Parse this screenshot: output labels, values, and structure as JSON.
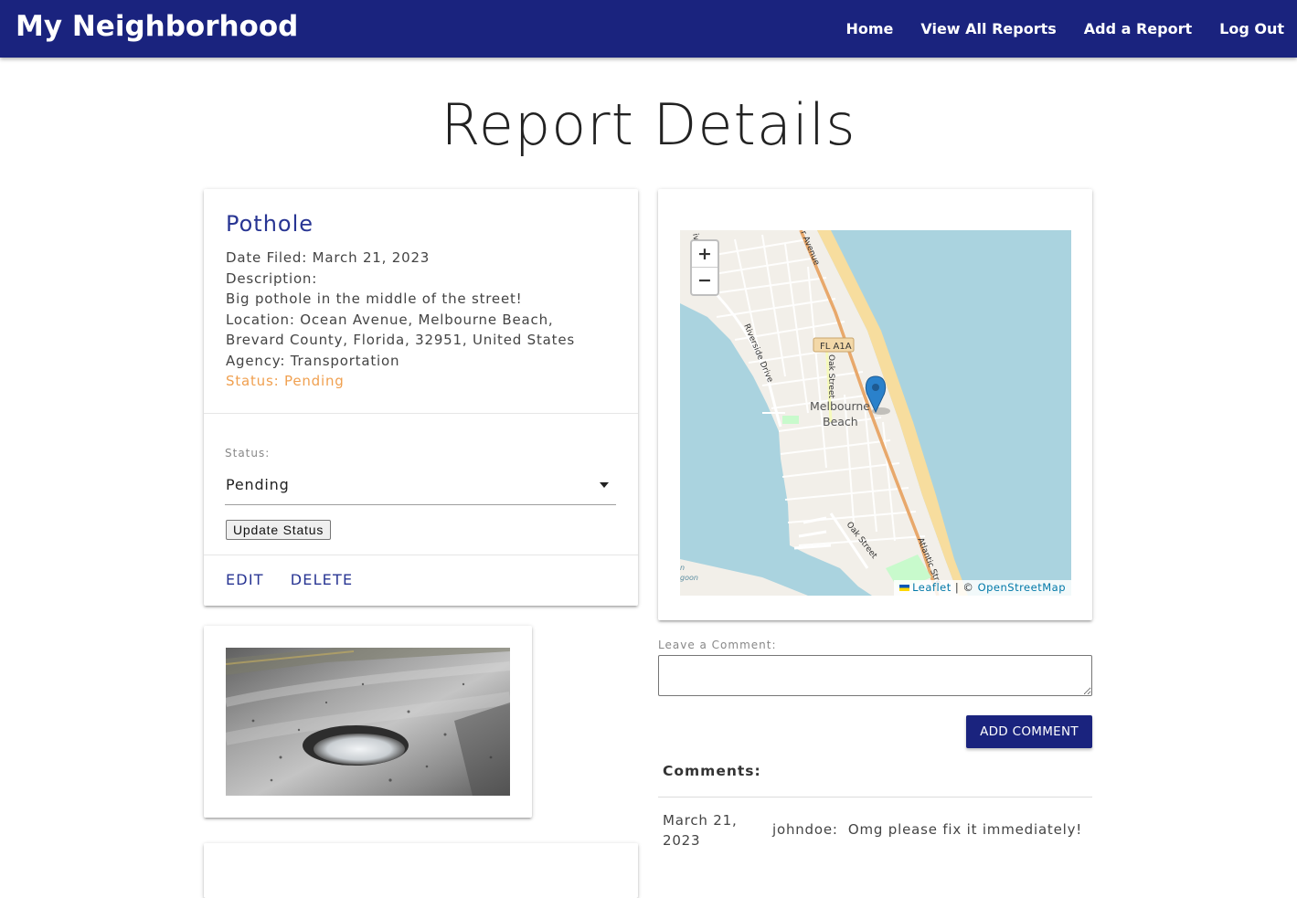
{
  "navbar": {
    "brand": "My Neighborhood",
    "links": [
      "Home",
      "View All Reports",
      "Add a Report",
      "Log Out"
    ]
  },
  "page_title": "Report Details",
  "report": {
    "title": "Pothole",
    "date_filed": "Date Filed: March 21, 2023",
    "description_label": "Description:",
    "description": "Big pothole in the middle of the street!",
    "location_line1": "Location: Ocean Avenue, Melbourne Beach,",
    "location_line2": "Brevard County, Florida, 32951, United States",
    "agency": "Agency: Transportation",
    "status": "Status: Pending",
    "status_color": "#f0a050"
  },
  "status_form": {
    "label": "Status:",
    "selected": "Pending",
    "update_button": "Update Status"
  },
  "actions": {
    "edit": "EDIT",
    "delete": "DELETE"
  },
  "map": {
    "zoom_in": "+",
    "zoom_out": "−",
    "labels": {
      "fl_a1a": "FL A1A",
      "oak_street": "Oak Street",
      "oak_street_2": "Oak Street",
      "riverside": "Riverside Drive",
      "atlantic": "Atlantic Stre",
      "avenue": "r Avenue",
      "town": "Melbourne",
      "town2": "Beach",
      "corner_top": "ive",
      "corner_bottom_1": "n",
      "corner_bottom_2": "goon"
    },
    "attribution_leaflet": "Leaflet",
    "attribution_sep": " | © ",
    "attribution_osm": "OpenStreetMap",
    "marker_icon": "map-marker-icon"
  },
  "comment_form": {
    "label": "Leave a Comment:",
    "value": "",
    "button": "ADD COMMENT"
  },
  "comments": {
    "title": "Comments:",
    "items": [
      {
        "date_line1": "March 21,",
        "date_line2": "2023",
        "user": "johndoe:",
        "text": "Omg please fix it immediately!"
      }
    ]
  },
  "colors": {
    "navbar": "#1a237e",
    "link_accent": "#283593",
    "pending": "#f0a050",
    "water": "#a9d3df"
  }
}
